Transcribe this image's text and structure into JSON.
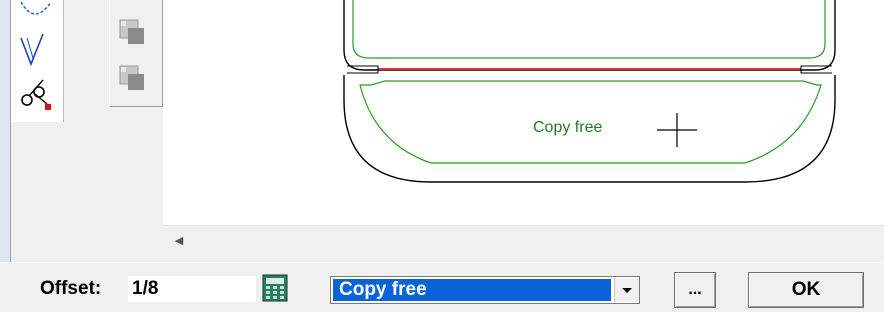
{
  "canvas": {
    "label": "Copy free",
    "colors": {
      "outline": "#000000",
      "offset_line": "#20a020",
      "divider": "#e03030",
      "label": "#208020"
    }
  },
  "toolbar": {
    "tools": [
      "circle-tool-icon",
      "v-cut-tool-icon",
      "scissors-tool-icon"
    ],
    "secondary": [
      "copy-square-icon",
      "copy-square-icon"
    ]
  },
  "bottom": {
    "offset_label": "Offset:",
    "offset_value": "1/8",
    "mode_selected": "Copy free",
    "more_label": "...",
    "ok_label": "OK",
    "accent": "#0a64d8"
  }
}
